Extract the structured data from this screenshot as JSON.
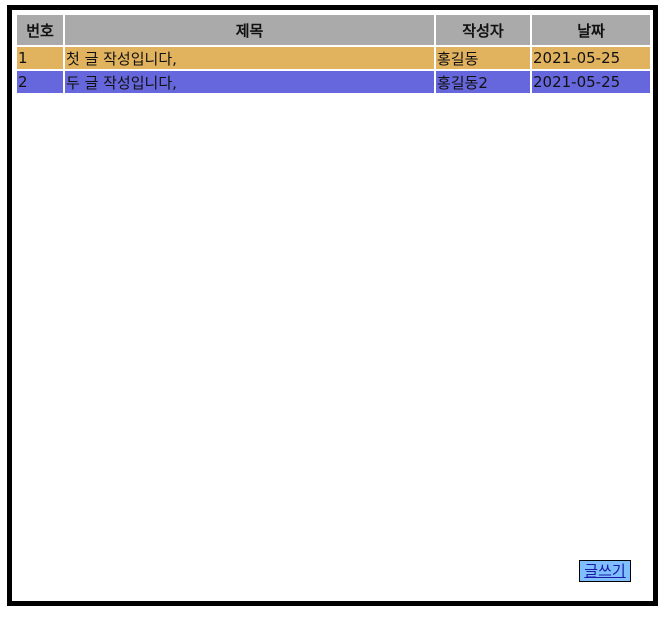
{
  "colors": {
    "header_bg": "#aaaaaa",
    "row_odd_bg": "#e2b35f",
    "row_even_bg": "#6666dd",
    "button_bg": "#7fbfff",
    "frame_border": "#000000"
  },
  "table": {
    "columns": [
      "번호",
      "제목",
      "작성자",
      "날짜"
    ],
    "rows": [
      {
        "no": "1",
        "title": "첫 글 작성입니다,",
        "author": "홍길동",
        "date": "2021-05-25"
      },
      {
        "no": "2",
        "title": "두 글 작성입니다,",
        "author": "홍길동2",
        "date": "2021-05-25"
      }
    ]
  },
  "actions": {
    "write_label": "글쓰기"
  }
}
